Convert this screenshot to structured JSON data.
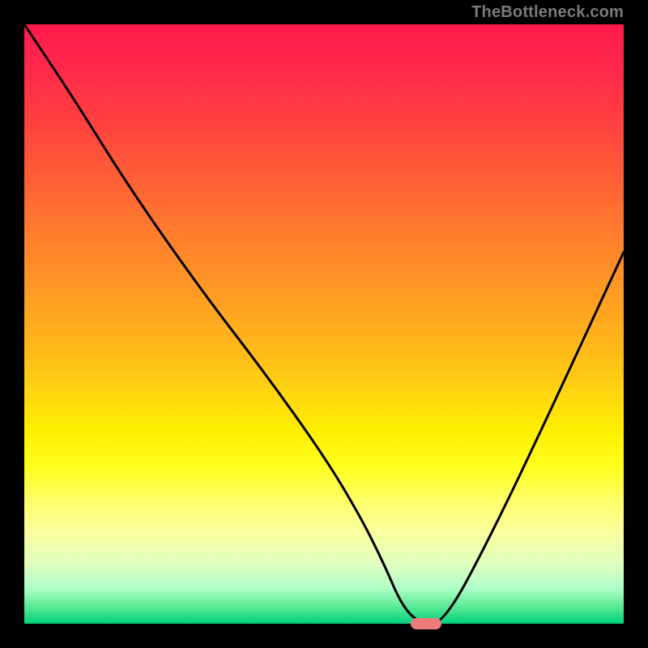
{
  "watermark": "TheBottleneck.com",
  "colors": {
    "frame_bg": "#000000",
    "gradient_top": "#ff1a4d",
    "gradient_bottom": "#00d080",
    "curve_stroke": "#000000",
    "marker_fill": "#ef7a7a",
    "watermark_color": "#7a7a7a"
  },
  "chart_data": {
    "type": "line",
    "title": "",
    "xlabel": "",
    "ylabel": "",
    "xlim": [
      0,
      100
    ],
    "ylim": [
      0,
      100
    ],
    "grid": false,
    "legend": false,
    "annotations": [
      "TheBottleneck.com"
    ],
    "series": [
      {
        "name": "bottleneck-curve",
        "x": [
          0,
          8,
          18,
          30,
          40,
          50,
          56,
          60,
          63,
          66,
          70,
          78,
          88,
          100
        ],
        "values": [
          100,
          88,
          72,
          55,
          42,
          28,
          18,
          10,
          3,
          0,
          0,
          15,
          36,
          62
        ]
      }
    ],
    "marker": {
      "x": 67,
      "y": 0,
      "shape": "pill",
      "color": "#ef7a7a"
    }
  }
}
